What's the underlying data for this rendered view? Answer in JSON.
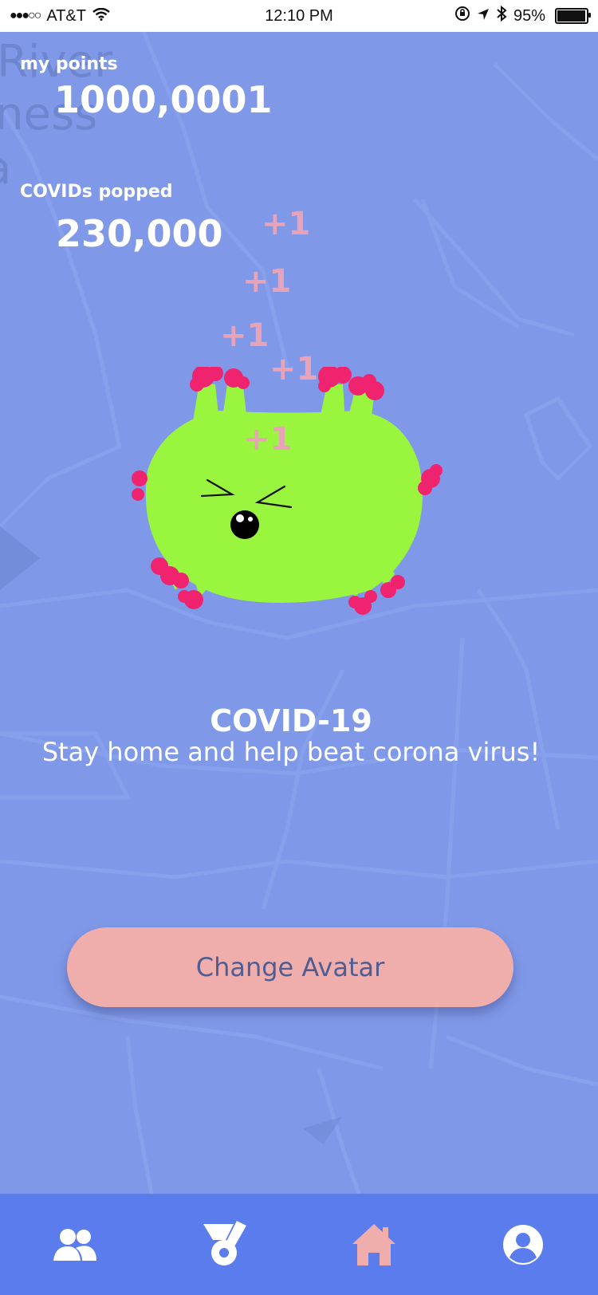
{
  "status_bar": {
    "signal": "●●●○○",
    "carrier": "AT&T",
    "time": "12:10 PM",
    "battery": "95%"
  },
  "map": {
    "labels": [
      "River",
      "ness",
      "a"
    ]
  },
  "stats": {
    "points_label": "my points",
    "points_value": "1000,0001",
    "popped_label": "COVIDs popped",
    "popped_value": "230,000"
  },
  "floaters": [
    "+1",
    "+1",
    "+1",
    "+1",
    "+1"
  ],
  "character": {
    "title": "COVID-19",
    "subtitle": "Stay home and help beat corona virus!"
  },
  "button": {
    "label": "Change Avatar"
  },
  "nav": {
    "items": [
      "friends-icon",
      "medal-icon",
      "home-icon",
      "profile-icon"
    ],
    "active": "home-icon"
  },
  "colors": {
    "background": "#7f99e8",
    "navbar": "#5b7ced",
    "button": "#efaeac",
    "button_text": "#4f5d93",
    "virus_body": "#9af53f",
    "virus_spikes": "#f0236f",
    "floater": "#e9a3b8"
  }
}
